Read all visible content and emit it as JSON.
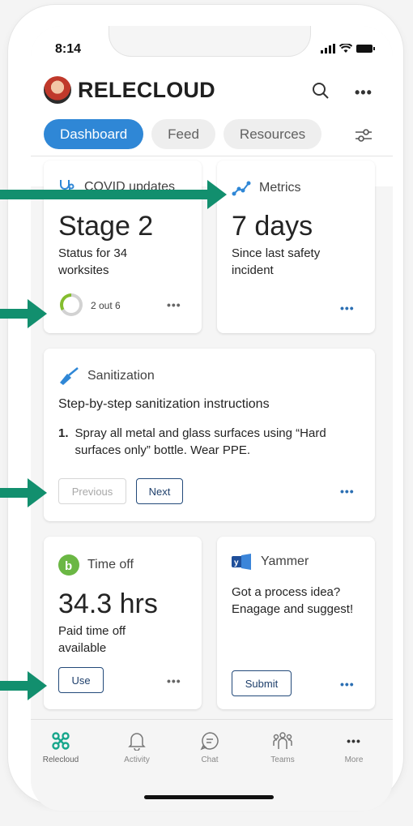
{
  "status_bar": {
    "time": "8:14"
  },
  "header": {
    "brand": "RELECLOUD"
  },
  "tabs": [
    {
      "label": "Dashboard"
    },
    {
      "label": "Feed"
    },
    {
      "label": "Resources"
    }
  ],
  "cards": {
    "covid": {
      "title": "COVID updates",
      "value": "Stage 2",
      "subtitle": "Status for 34 worksites",
      "progress_text": "2 out 6",
      "progress_fraction": 0.33
    },
    "metrics": {
      "title": "Metrics",
      "value": "7 days",
      "subtitle": "Since last safety incident"
    },
    "sanitization": {
      "title": "Sanitization",
      "heading": "Step-by-step sanitization instructions",
      "step_number": "1.",
      "step_text": "Spray all metal and glass surfaces using “Hard surfaces only” bottle. Wear PPE.",
      "prev_label": "Previous",
      "next_label": "Next"
    },
    "timeoff": {
      "title": "Time off",
      "value": "34.3 hrs",
      "subtitle": "Paid time off available",
      "button_label": "Use"
    },
    "yammer": {
      "title": "Yammer",
      "text": "Got a process idea? Enagage and suggest!",
      "button_label": "Submit"
    }
  },
  "nav": [
    {
      "label": "Relecloud",
      "icon": "relecloud-icon"
    },
    {
      "label": "Activity",
      "icon": "bell-icon"
    },
    {
      "label": "Chat",
      "icon": "chat-icon"
    },
    {
      "label": "Teams",
      "icon": "teams-icon"
    },
    {
      "label": "More",
      "icon": "more-icon"
    }
  ],
  "colors": {
    "accent": "#2f87d6",
    "arrow": "#128f6e",
    "progress": "#84bd2e",
    "timeoff_icon": "#6bb744",
    "yammer": "#2a68c4"
  }
}
